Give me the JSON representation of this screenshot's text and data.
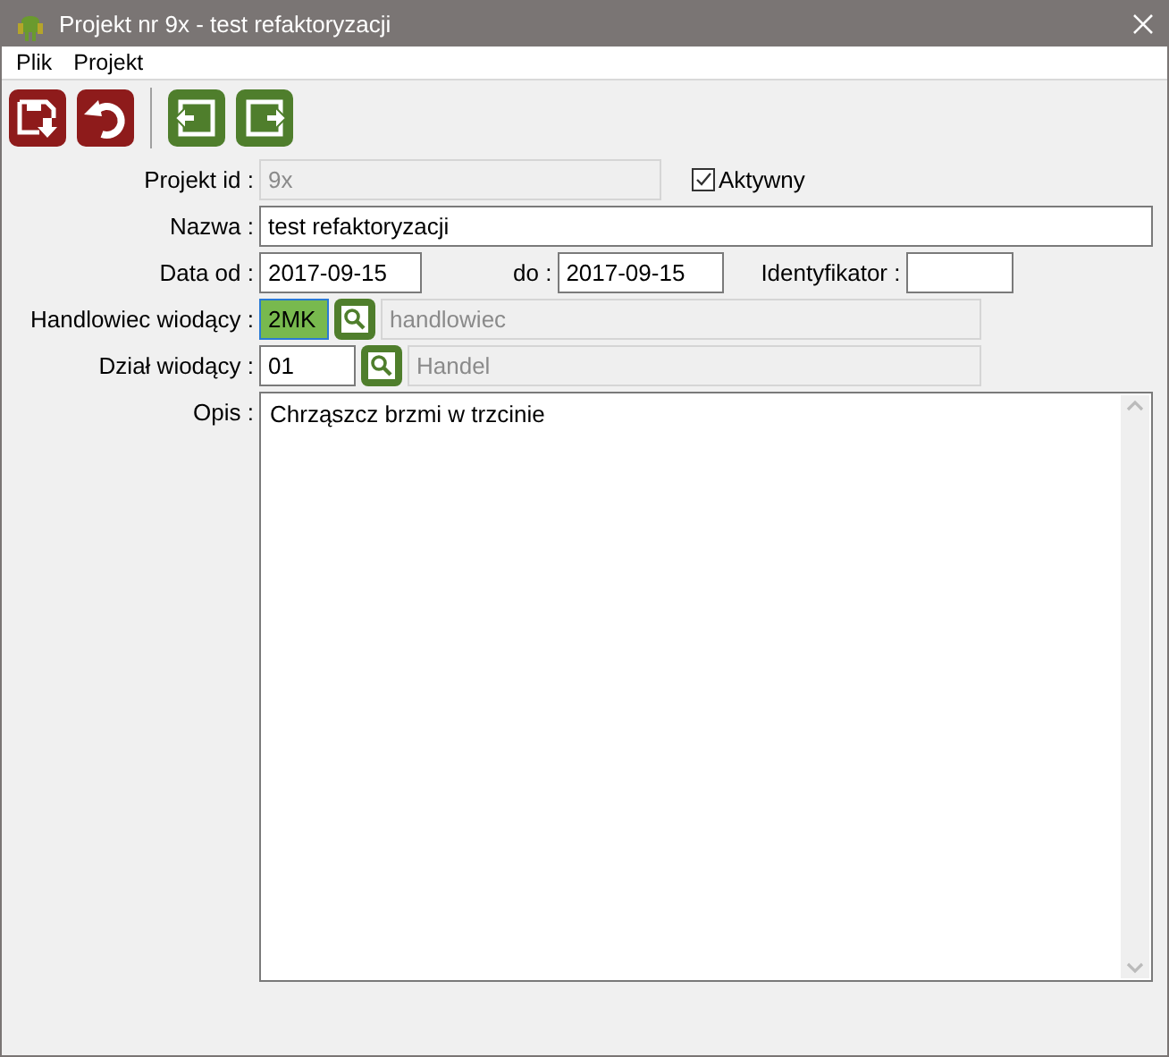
{
  "window": {
    "title": "Projekt nr 9x - test refaktoryzacji"
  },
  "menu": [
    {
      "label": "Plik"
    },
    {
      "label": "Projekt"
    }
  ],
  "toolbar_groups": [
    [
      {
        "kind": "save"
      },
      {
        "kind": "undo"
      }
    ],
    [
      {
        "kind": "previous"
      },
      {
        "kind": "next"
      }
    ]
  ],
  "form": {
    "project_id": {
      "label": "Projekt id :",
      "value": "9x",
      "disabled": true
    },
    "active": {
      "label": "Aktywny",
      "checked": true
    },
    "name": {
      "label": "Nazwa :",
      "value": "test refaktoryzacji"
    },
    "date_from": {
      "label": "Data od :",
      "value": "2017-09-15"
    },
    "date_to": {
      "label": "do :",
      "value": "2017-09-15"
    },
    "identifier": {
      "label": "Identyfikator :"
    },
    "salesperson": {
      "label": "Handlowiec wiodący :",
      "code": "2MK",
      "highlighted": true,
      "name": "handlowiec",
      "name_disabled": true
    },
    "department": {
      "label": "Dział wiodący :",
      "code": "01",
      "highlighted": false,
      "name": "Handel",
      "name_disabled": true
    },
    "description": {
      "label": "Opis :",
      "value": "Chrząszcz brzmi w trzcinie"
    }
  }
}
